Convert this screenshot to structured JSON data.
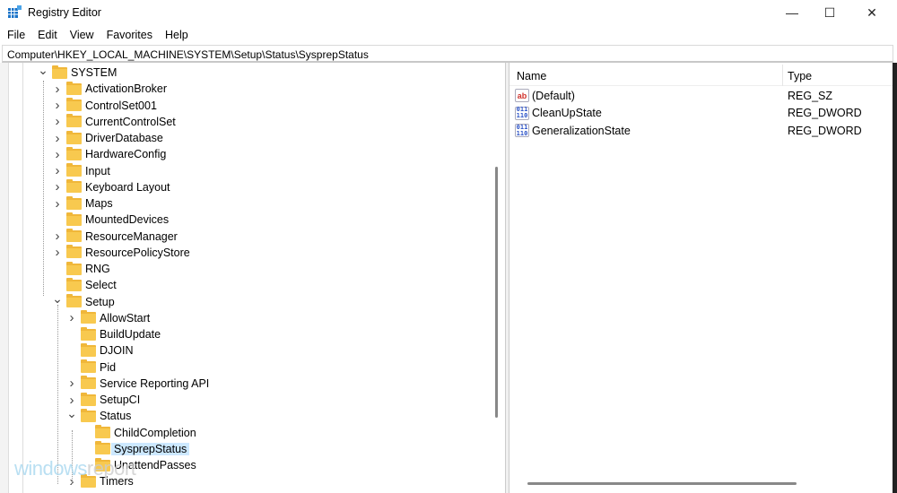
{
  "window": {
    "title": "Registry Editor",
    "minimize": "—",
    "maximize": "☐",
    "close": "✕"
  },
  "menu": [
    "File",
    "Edit",
    "View",
    "Favorites",
    "Help"
  ],
  "address": "Computer\\HKEY_LOCAL_MACHINE\\SYSTEM\\Setup\\Status\\SysprepStatus",
  "tree": [
    {
      "label": "SYSTEM",
      "level": 0,
      "chevron": "expanded"
    },
    {
      "label": "ActivationBroker",
      "level": 1,
      "chevron": "collapsed"
    },
    {
      "label": "ControlSet001",
      "level": 1,
      "chevron": "collapsed"
    },
    {
      "label": "CurrentControlSet",
      "level": 1,
      "chevron": "collapsed"
    },
    {
      "label": "DriverDatabase",
      "level": 1,
      "chevron": "collapsed"
    },
    {
      "label": "HardwareConfig",
      "level": 1,
      "chevron": "collapsed"
    },
    {
      "label": "Input",
      "level": 1,
      "chevron": "collapsed"
    },
    {
      "label": "Keyboard Layout",
      "level": 1,
      "chevron": "collapsed"
    },
    {
      "label": "Maps",
      "level": 1,
      "chevron": "collapsed"
    },
    {
      "label": "MountedDevices",
      "level": 1,
      "chevron": "none"
    },
    {
      "label": "ResourceManager",
      "level": 1,
      "chevron": "collapsed"
    },
    {
      "label": "ResourcePolicyStore",
      "level": 1,
      "chevron": "collapsed"
    },
    {
      "label": "RNG",
      "level": 1,
      "chevron": "none"
    },
    {
      "label": "Select",
      "level": 1,
      "chevron": "none"
    },
    {
      "label": "Setup",
      "level": 1,
      "chevron": "expanded"
    },
    {
      "label": "AllowStart",
      "level": 2,
      "chevron": "collapsed"
    },
    {
      "label": "BuildUpdate",
      "level": 2,
      "chevron": "none"
    },
    {
      "label": "DJOIN",
      "level": 2,
      "chevron": "none"
    },
    {
      "label": "Pid",
      "level": 2,
      "chevron": "none"
    },
    {
      "label": "Service Reporting API",
      "level": 2,
      "chevron": "collapsed"
    },
    {
      "label": "SetupCI",
      "level": 2,
      "chevron": "collapsed"
    },
    {
      "label": "Status",
      "level": 2,
      "chevron": "expanded"
    },
    {
      "label": "ChildCompletion",
      "level": 3,
      "chevron": "none"
    },
    {
      "label": "SysprepStatus",
      "level": 3,
      "chevron": "none",
      "selected": true
    },
    {
      "label": "UnattendPasses",
      "level": 3,
      "chevron": "none"
    },
    {
      "label": "Timers",
      "level": 2,
      "chevron": "collapsed"
    }
  ],
  "values": {
    "columns": {
      "name": "Name",
      "type": "Type"
    },
    "rows": [
      {
        "icon": "string-value-icon",
        "glyph": "ab",
        "name": "(Default)",
        "type": "REG_SZ"
      },
      {
        "icon": "binary-value-icon",
        "glyph": "011\n110",
        "name": "CleanUpState",
        "type": "REG_DWORD"
      },
      {
        "icon": "binary-value-icon",
        "glyph": "011\n110",
        "name": "GeneralizationState",
        "type": "REG_DWORD"
      }
    ]
  },
  "watermark": {
    "a": "windows",
    "b": "report"
  },
  "colors": {
    "selection": "#cce8ff",
    "folder": "#f8c94f"
  }
}
